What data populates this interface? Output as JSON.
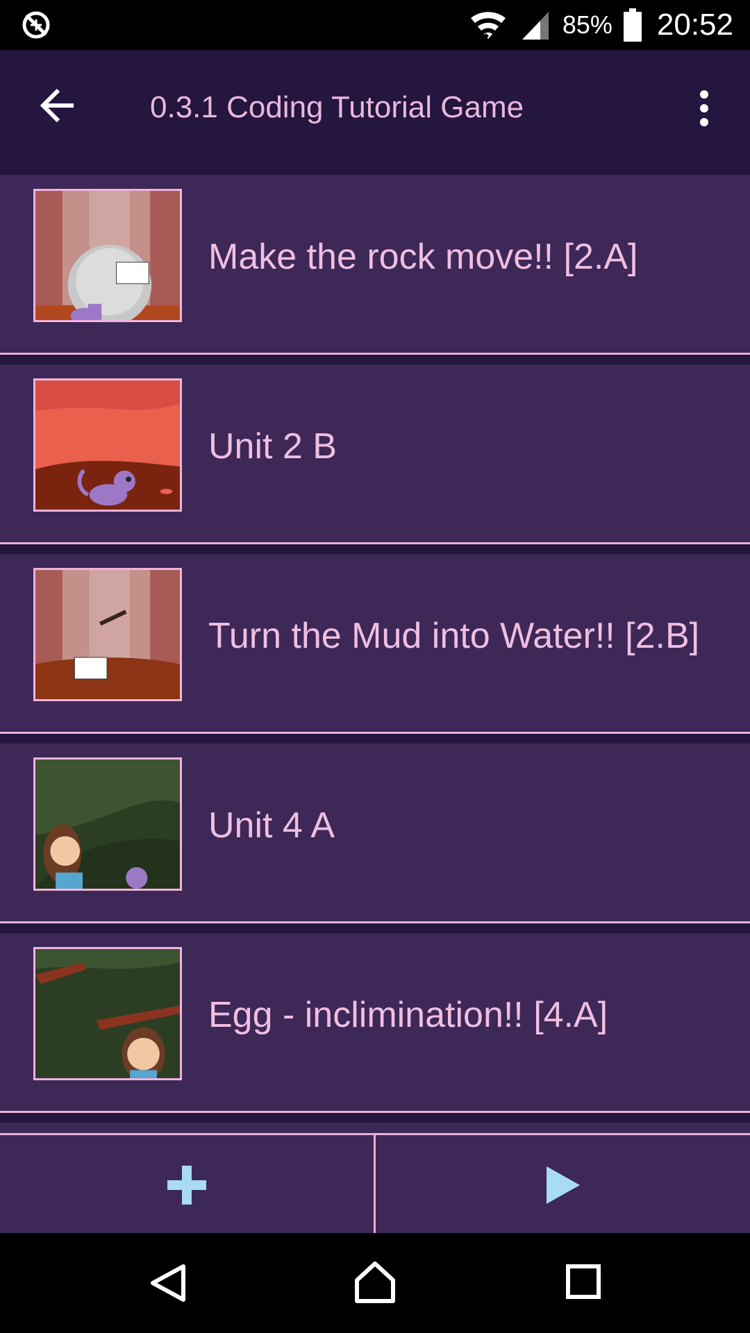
{
  "status_bar": {
    "left_icon": "data-saver-off-icon",
    "wifi_icon": "wifi-icon",
    "signal_icon": "cell-signal-icon",
    "battery_percent": "85%",
    "battery_icon": "battery-icon",
    "time": "20:52"
  },
  "toolbar": {
    "back_icon": "back-arrow-icon",
    "title": "0.3.1 Coding Tutorial Game",
    "menu_icon": "more-vert-icon"
  },
  "list": {
    "items": [
      {
        "label": "Make the rock move!! [2.A]"
      },
      {
        "label": "Unit 2 B"
      },
      {
        "label": "Turn the Mud into Water!! [2.B]"
      },
      {
        "label": "Unit 4 A"
      },
      {
        "label": "Egg - inclimination!! [4.A]"
      }
    ]
  },
  "bottom_bar": {
    "add_icon": "plus-icon",
    "play_icon": "play-icon",
    "accent_color": "#a7dcf2"
  },
  "nav_bar": {
    "back_icon": "nav-back-icon",
    "home_icon": "nav-home-icon",
    "recents_icon": "nav-recents-icon"
  },
  "colors": {
    "background": "#24163e",
    "item_background": "#3d2858",
    "text": "#f0bfe0",
    "divider": "#e8b0d7"
  }
}
